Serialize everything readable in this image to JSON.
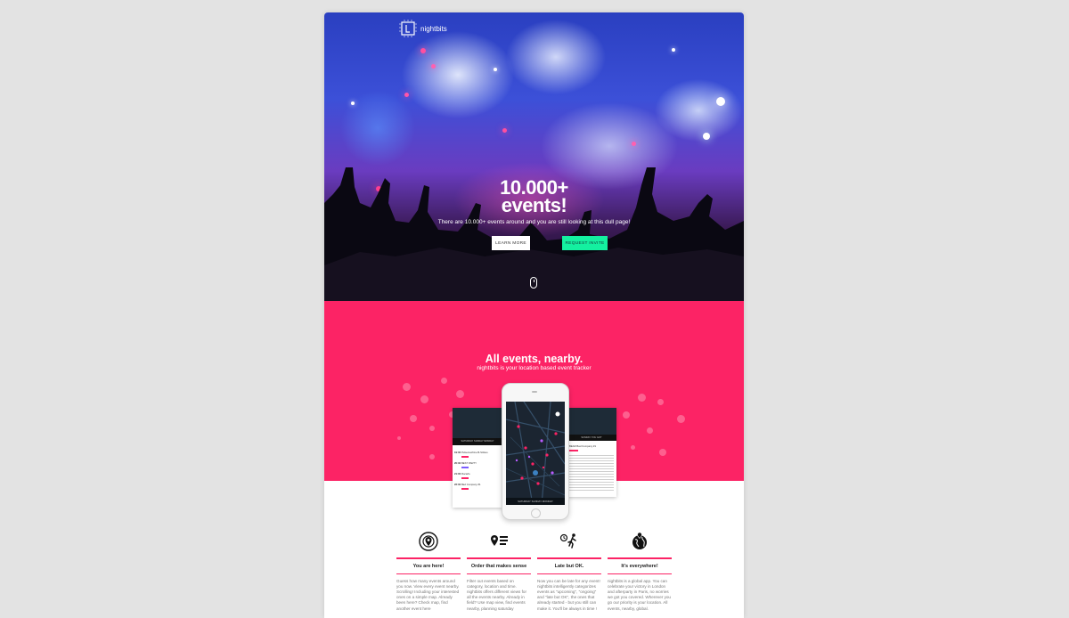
{
  "brand": {
    "name": "nightbits",
    "logo_icon": "nightbits-logo-icon"
  },
  "hero": {
    "title_line1": "10.000+",
    "title_line2": "events!",
    "subtitle": "There are 10.000+ events around and you are still looking at this dull page!",
    "learn_more": "LEARN MORE",
    "request_invite": "REQUEST INVITE",
    "scroll_icon": "mouse-scroll-icon"
  },
  "section": {
    "title": "All events, nearby.",
    "subtitle": "nightbits is your location based event tracker"
  },
  "app": {
    "days_left": "SATURDAY  SUNDAY  MONDAY",
    "days_phone": "SATURDAY  SUNDAY  MONDAY",
    "right_header": "SUNDAY YOU GOT",
    "right_item": "BEAR Bad Company #1",
    "list": [
      {
        "time": "19:30",
        "name": "Pulsemachine B-Strikes"
      },
      {
        "time": "20:30",
        "name": "BEST PARTY"
      },
      {
        "time": "21:00",
        "name": "Rocarfe"
      },
      {
        "time": "22:30",
        "name": "Bad Company #1"
      }
    ]
  },
  "features": [
    {
      "icon": "location-target-icon",
      "title": "You are here!",
      "text": "Guess how many events around you now.\nView every event nearby. Scrolling! Including your interested ones on a simple map. Already been here?\nCheck map, find another event here"
    },
    {
      "icon": "order-list-icon",
      "title": "Order that makes sense",
      "text": "Filter out events based on category, location and time. nightbits offers different views for all the events nearby.\nAlready in field? Use map view, find events nearby, planning saturday"
    },
    {
      "icon": "late-runner-icon",
      "title": "Late but OK.",
      "text": "Now you can be late for any event! nightbits intelligently categorizes events as \"upcoming\", \"ongoing\" and \"late but OK\", the ones that already started - but you still can make it. You'll be always in time !"
    },
    {
      "icon": "globe-icon",
      "title": "It's everywhere!",
      "text": "nightbits is a global app. You can celebrate your victory in London and afterparty in Paris, no worries we got you covered. Wherever you go our priority is your location. All events, nearby, global."
    }
  ],
  "colors": {
    "accent": "#fc2365",
    "mint": "#14f0a0",
    "background": "#e3e3e3"
  }
}
